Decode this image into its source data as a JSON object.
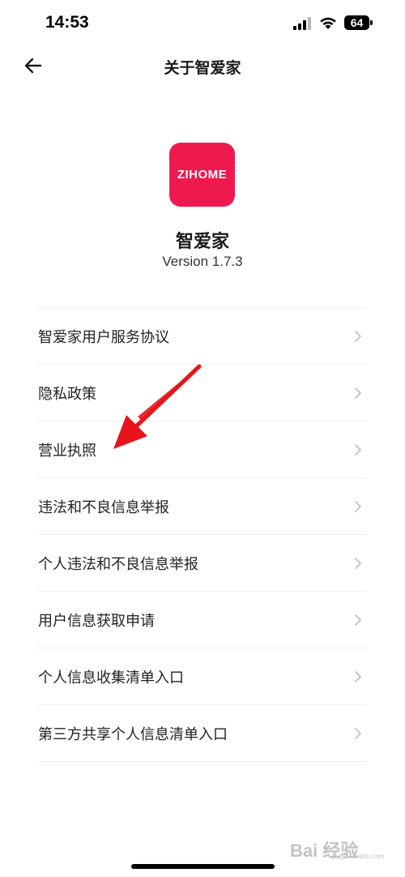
{
  "status_bar": {
    "time": "14:53",
    "battery_level": "64",
    "icons": [
      "signal-icon",
      "wifi-icon",
      "battery-icon"
    ]
  },
  "nav": {
    "title": "关于智爱家",
    "back_icon": "arrow-left-icon"
  },
  "app": {
    "icon_text": "ZIHOME",
    "name": "智爱家",
    "version": "Version 1.7.3",
    "brand_color": "#ee1a4f"
  },
  "menu": {
    "items": [
      {
        "label": "智爱家用户服务协议"
      },
      {
        "label": "隐私政策"
      },
      {
        "label": "营业执照"
      },
      {
        "label": "违法和不良信息举报"
      },
      {
        "label": "个人违法和不良信息举报"
      },
      {
        "label": "用户信息获取申请"
      },
      {
        "label": "个人信息收集清单入口"
      },
      {
        "label": "第三方共享个人信息清单入口"
      }
    ],
    "chevron_icon": "chevron-right-icon"
  },
  "annotation": {
    "icon": "red-arrow-icon",
    "color": "#e8141c"
  },
  "watermark": {
    "text": "Bai 经验",
    "sub": "jingyan.baidu.com"
  }
}
